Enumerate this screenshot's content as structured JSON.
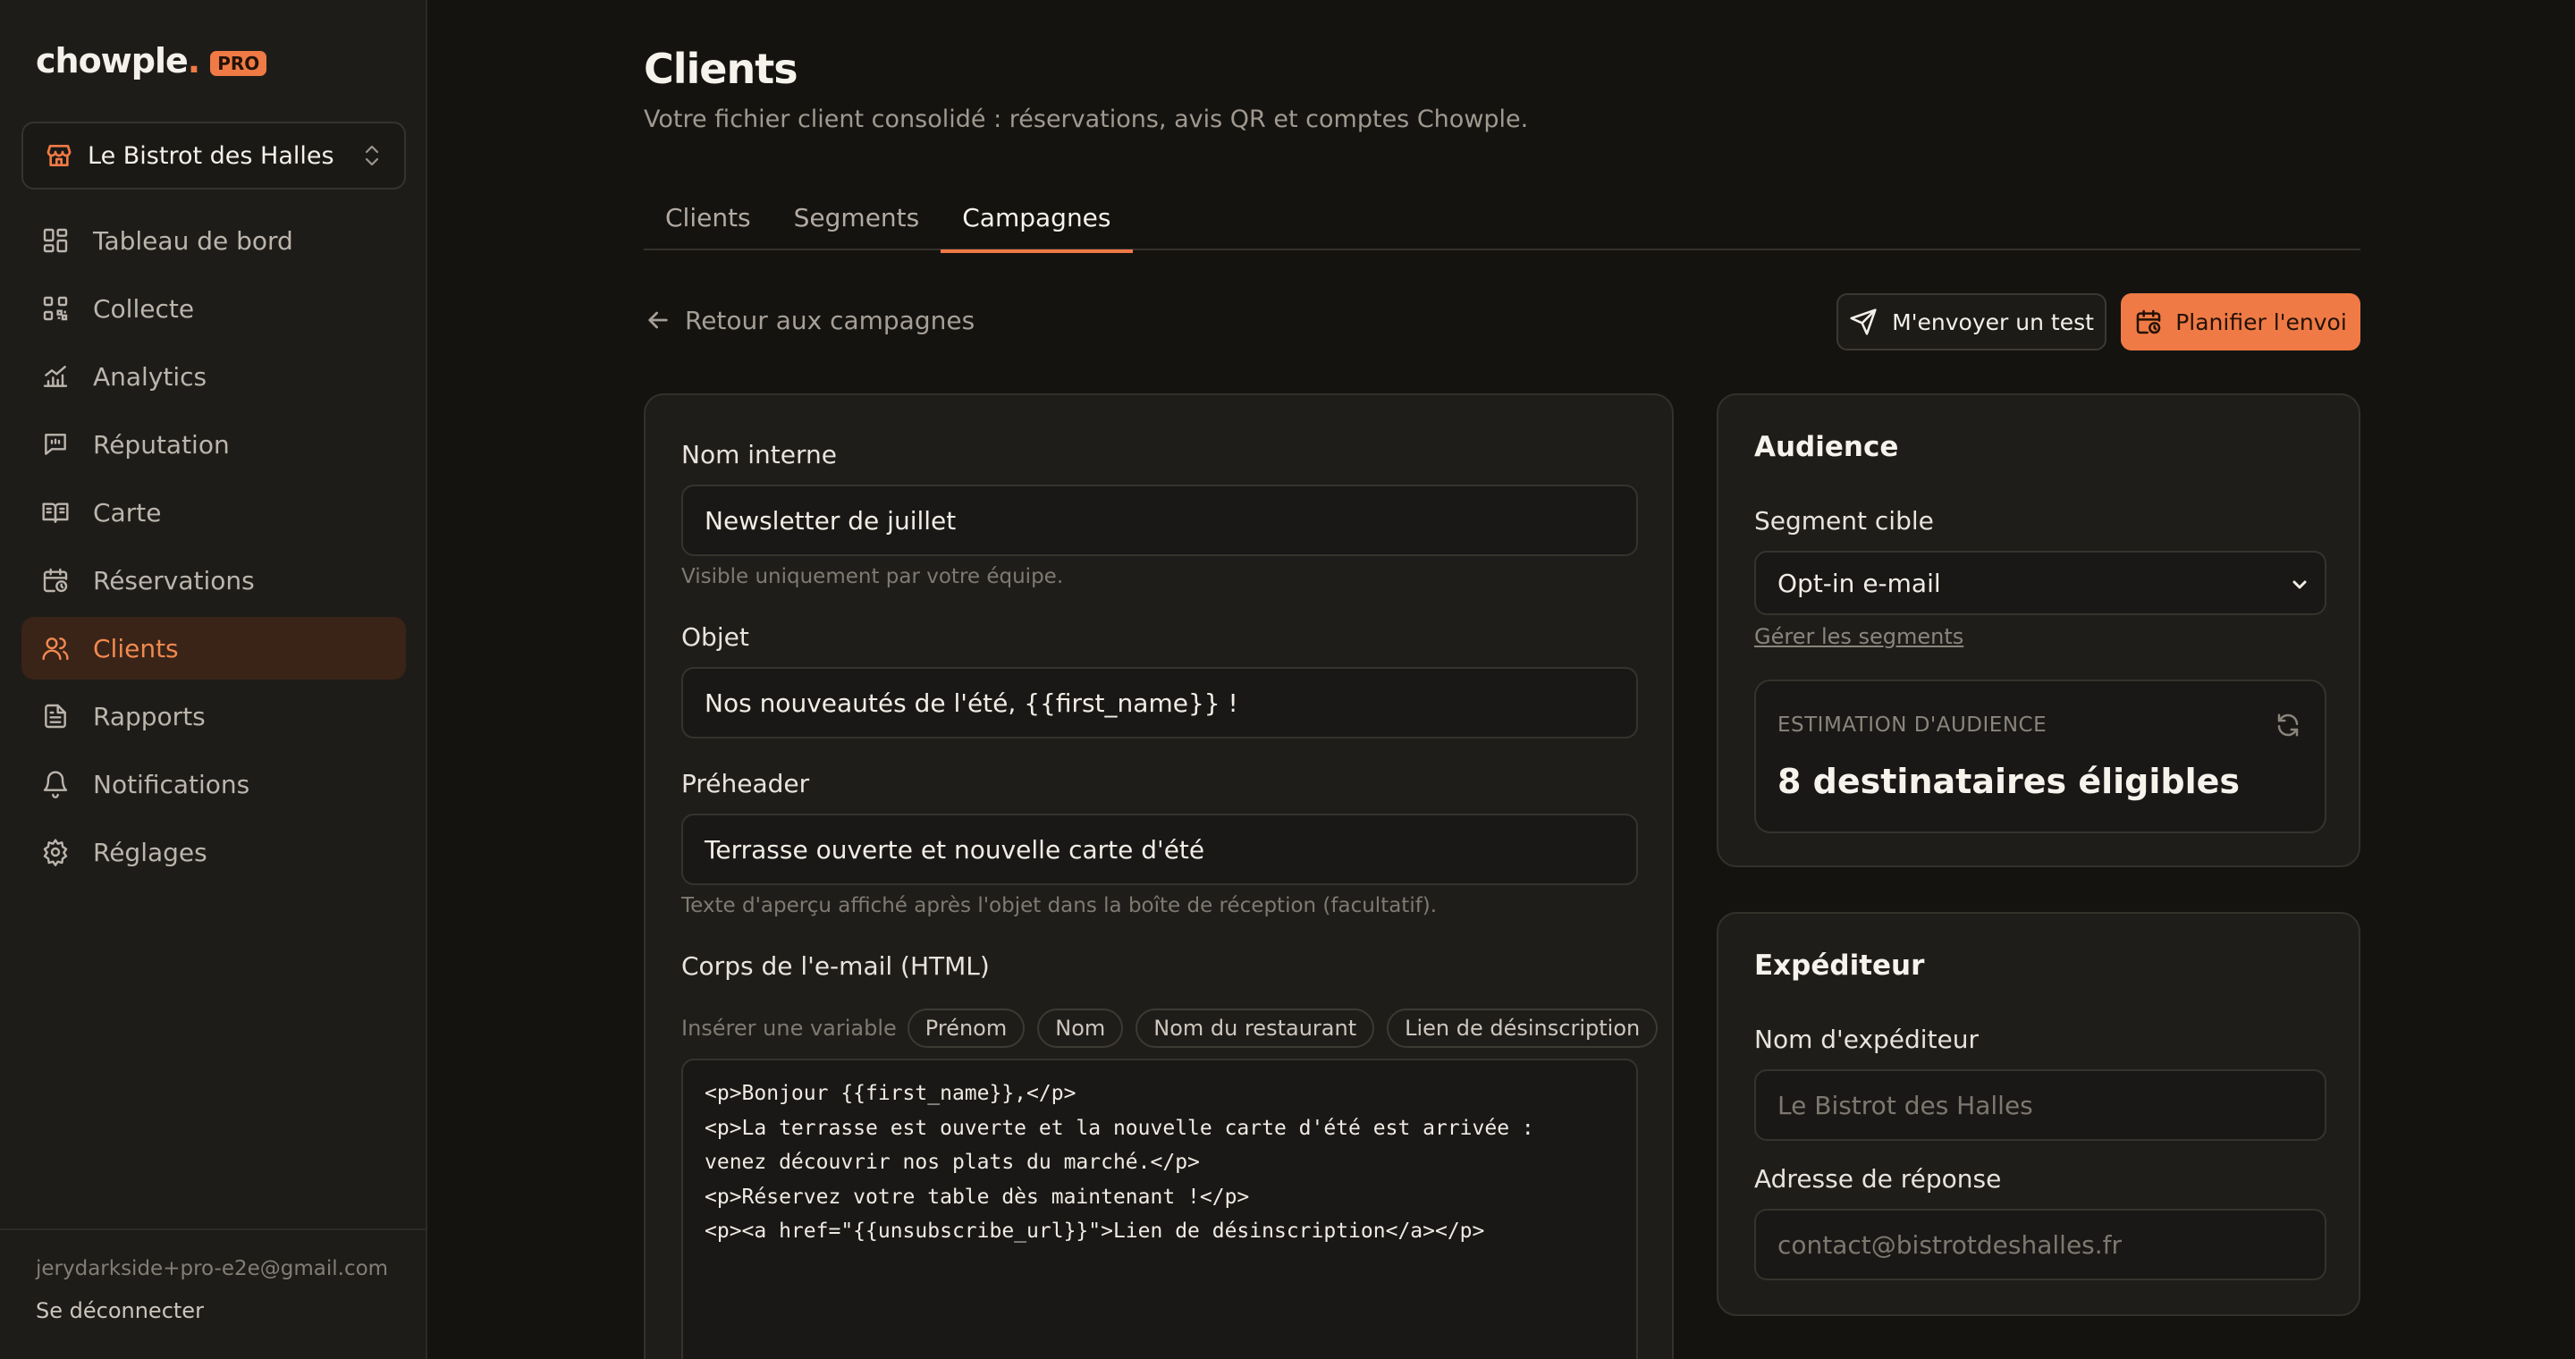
{
  "brand": {
    "name": "chowple",
    "dot": ".",
    "badge": "PRO",
    "accent": "#f07a45"
  },
  "restaurant_selector": {
    "name": "Le Bistrot des Halles"
  },
  "sidebar": {
    "items": [
      {
        "label": "Tableau de bord",
        "icon": "dashboard-icon"
      },
      {
        "label": "Collecte",
        "icon": "qr-code-icon"
      },
      {
        "label": "Analytics",
        "icon": "chart-icon"
      },
      {
        "label": "Réputation",
        "icon": "review-icon"
      },
      {
        "label": "Carte",
        "icon": "menu-book-icon"
      },
      {
        "label": "Réservations",
        "icon": "calendar-clock-icon"
      },
      {
        "label": "Clients",
        "icon": "users-icon",
        "active": true
      },
      {
        "label": "Rapports",
        "icon": "file-text-icon"
      },
      {
        "label": "Notifications",
        "icon": "bell-icon"
      },
      {
        "label": "Réglages",
        "icon": "gear-icon"
      }
    ],
    "user_email": "jerydarkside+pro-e2e@gmail.com",
    "logout": "Se déconnecter"
  },
  "header": {
    "title": "Clients",
    "subtitle": "Votre fichier client consolidé : réservations, avis QR et comptes Chowple."
  },
  "tabs": [
    {
      "label": "Clients",
      "active": false
    },
    {
      "label": "Segments",
      "active": false
    },
    {
      "label": "Campagnes",
      "active": true
    }
  ],
  "toolbar": {
    "back": "Retour aux campagnes",
    "test_button": "M'envoyer un test",
    "schedule_button": "Planifier l'envoi"
  },
  "form": {
    "internal_name": {
      "label": "Nom interne",
      "value": "Newsletter de juillet",
      "hint": "Visible uniquement par votre équipe."
    },
    "subject": {
      "label": "Objet",
      "value": "Nos nouveautés de l'été, {{first_name}} !"
    },
    "preheader": {
      "label": "Préheader",
      "value": "Terrasse ouverte et nouvelle carte d'été",
      "hint": "Texte d'aperçu affiché après l'objet dans la boîte de réception (facultatif)."
    },
    "body": {
      "label": "Corps de l'e-mail (HTML)",
      "insert_label": "Insérer une variable",
      "variables": [
        "Prénom",
        "Nom",
        "Nom du restaurant",
        "Lien de désinscription"
      ],
      "code": "<p>Bonjour {{first_name}},</p>\n<p>La terrasse est ouverte et la nouvelle carte d'été est arrivée :\nvenez découvrir nos plats du marché.</p>\n<p>Réservez votre table dès maintenant !</p>\n<p><a href=\"{{unsubscribe_url}}\">Lien de désinscription</a></p>"
    }
  },
  "audience": {
    "title": "Audience",
    "segment_label": "Segment cible",
    "segment_value": "Opt-in e-mail",
    "manage_link": "Gérer les segments",
    "estimate_label": "ESTIMATION D'AUDIENCE",
    "estimate_value": "8 destinataires éligibles"
  },
  "sender": {
    "title": "Expéditeur",
    "name_label": "Nom d'expéditeur",
    "name_placeholder": "Le Bistrot des Halles",
    "reply_label": "Adresse de réponse",
    "reply_placeholder": "contact@bistrotdeshalles.fr"
  }
}
